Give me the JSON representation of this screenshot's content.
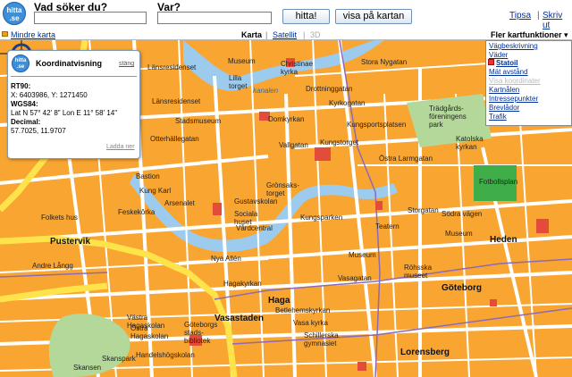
{
  "header": {
    "logo_text_1": "hitta",
    "logo_text_2": ".se",
    "what_label": "Vad söker du?",
    "what_value": "",
    "where_label": "Var?",
    "where_value": "",
    "search_button": "hitta!",
    "show_on_map_button": "visa på kartan",
    "tips_link": "Tipsa",
    "separator": "|",
    "print_link": "Skriv ut"
  },
  "toolbar": {
    "smaller_map": "Mindre karta",
    "map_tab": "Karta",
    "separator": "|",
    "satellite_tab": "Satellit",
    "three_d_tab": "3D",
    "more_functions": "Fler kartfunktioner ▾"
  },
  "coordinate_popup": {
    "logo_text_1": "hitta",
    "logo_text_2": ".se",
    "title": "Koordinatvisning",
    "close": "stäng",
    "rt90_label": "RT90:",
    "rt90_value": "X: 6403986, Y: 1271450",
    "wgs84_label": "WGS84:",
    "wgs84_value": "Lat N 57° 42' 8\" Lon E 11° 58' 14\"",
    "decimal_label": "Decimal:",
    "decimal_value": "57.7025, 11.9707",
    "download": "Ladda ner"
  },
  "map_functions_menu": {
    "items": [
      {
        "label": "Vägbeskrivning"
      },
      {
        "label": "Väder"
      },
      {
        "label": "Statoil"
      },
      {
        "label": "Mät avstånd"
      },
      {
        "label": "Visa koordinater"
      },
      {
        "label": "Kartnålen"
      },
      {
        "label": "Intressepunkter"
      },
      {
        "label": "Brevlådor"
      },
      {
        "label": "Trafik"
      }
    ]
  },
  "map_labels": {
    "lansresidenset": "Länsresidenset",
    "lansresidenset2": "Länsresidenset",
    "museum1": "Museum",
    "christinae": "Christinae\nkyrka",
    "storanygatan": "Stora Nygatan",
    "lilla_torget": "Lilla\ntorget",
    "kanalen": "kanalen",
    "drottninggatan": "Drottninggatan",
    "kyrkogatan": "Kyrkogatan",
    "stadsmuseum": "Stadsmuseum",
    "domkyrkan": "Domkyrkan",
    "ottehallegatan": "Otterhällegatan",
    "kungsportsplatsen": "Kungsportsplatsen",
    "tradgardsforeningens": "Trädgårds-\nföreningens\npark",
    "kungstorget": "Kungstorget",
    "vallgatan": "Vallgatan",
    "bastion": "Bastion",
    "kung_karl": "Kung Karl",
    "arsenalet": "Arsenalet",
    "feskekorka": "Feskekôrka",
    "folkets_hus": "Folkets hus",
    "gustavskolan": "Gustavskolan",
    "sociala_huset": "Sociala\nhuset",
    "vardcentral": "Vårdcentral",
    "kungsparken": "Kungsparken",
    "gronsaks_torget": "Grönsaks-\ntorget",
    "pustervik": "Pustervik",
    "nya_allen": "Nya Allén",
    "andre_lange": "Andre Långg",
    "hagakyrkan": "Hagakyrkan",
    "haga": "Haga",
    "vasastaden": "Vasastaden",
    "bellevuekyrkan": "Betlehemskyrkan",
    "vasa_kyrka": "Vasa kyrka",
    "ostra_hagaskolan": "Östra\nHagaskolan",
    "vastra_hagaskolan": "Västra\nHagaskolan",
    "goteborgs_stadsbibliotek": "Göteborgs\nstads-\nbibliotek",
    "handelshogskolan": "Handelshögskolan",
    "skansen": "Skansen",
    "skanspark": "Skanspark",
    "heden": "Heden",
    "goteborg": "Göteborg",
    "lorensberg": "Lorensberg",
    "rohsska_museet": "Röhsska\nmuseet",
    "schillerska": "Schillerska\ngymnasiet",
    "fotbollsplan": "Fotbollsplan",
    "katolska": "Katolska\nkyrkan",
    "museum2": "Museum",
    "museum3": "Museum",
    "teatern": "Teatern",
    "ostra_larmgatan": "Östra Larmgatan",
    "sodra_vagen": "Södra vägen",
    "storgatan": "Storgatan",
    "vasagatan": "Vasagatan"
  }
}
